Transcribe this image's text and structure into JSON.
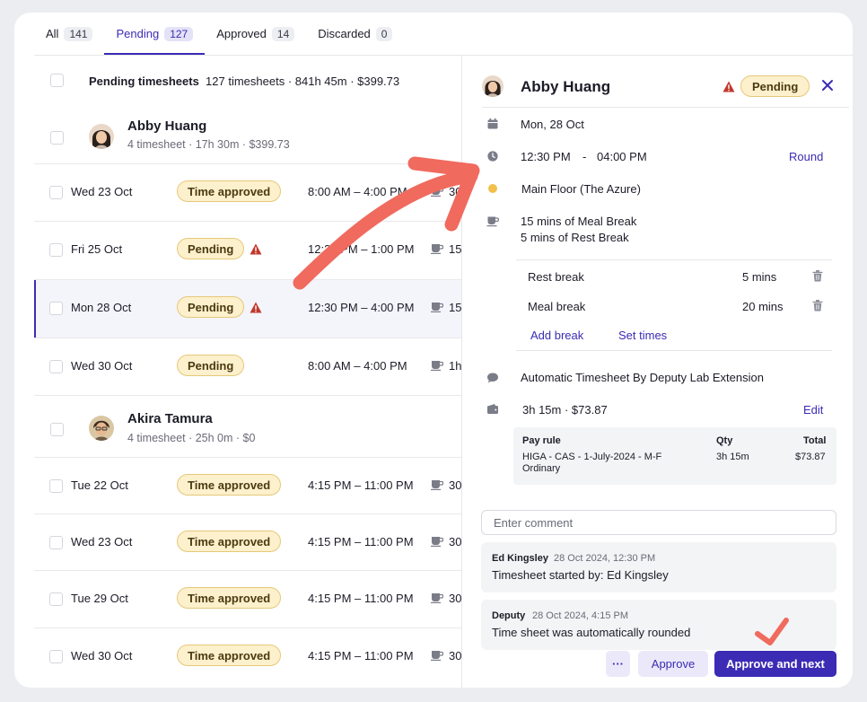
{
  "tabs": [
    {
      "label": "All",
      "count": "141"
    },
    {
      "label": "Pending",
      "count": "127"
    },
    {
      "label": "Approved",
      "count": "14"
    },
    {
      "label": "Discarded",
      "count": "0"
    }
  ],
  "summary": {
    "title": "Pending timesheets",
    "details": "127 timesheets · 841h 45m · $399.73"
  },
  "groups": [
    {
      "name": "Abby Huang",
      "meta": "4 timesheet · 17h 30m · $399.73"
    },
    {
      "name": "Akira Tamura",
      "meta": "4 timesheet · 25h 0m · $0"
    }
  ],
  "rows": [
    {
      "date": "Wed 23 Oct",
      "status": "Time approved",
      "time": "8:00 AM – 4:00 PM",
      "break": "30"
    },
    {
      "date": "Fri 25 Oct",
      "status": "Pending",
      "time": "12:30 PM – 1:00 PM",
      "break": "15"
    },
    {
      "date": "Mon 28 Oct",
      "status": "Pending",
      "time": "12:30 PM – 4:00 PM",
      "break": "15"
    },
    {
      "date": "Wed 30 Oct",
      "status": "Pending",
      "time": "8:00 AM – 4:00 PM",
      "break": "1h"
    },
    {
      "date": "Tue 22 Oct",
      "status": "Time approved",
      "time": "4:15 PM – 11:00 PM",
      "break": "30"
    },
    {
      "date": "Wed 23 Oct",
      "status": "Time approved",
      "time": "4:15 PM – 11:00 PM",
      "break": "30"
    },
    {
      "date": "Tue 29 Oct",
      "status": "Time approved",
      "time": "4:15 PM – 11:00 PM",
      "break": "30"
    },
    {
      "date": "Wed 30 Oct",
      "status": "Time approved",
      "time": "4:15 PM – 11:00 PM",
      "break": "30"
    }
  ],
  "detail": {
    "name": "Abby Huang",
    "status": "Pending",
    "date": "Mon, 28 Oct",
    "start": "12:30 PM",
    "separator": "-",
    "end": "04:00 PM",
    "round_label": "Round",
    "location": "Main Floor (The Azure)",
    "break_summary_1": "15 mins of Meal Break",
    "break_summary_2": "5 mins of Rest Break",
    "breaks": [
      {
        "label": "Rest break",
        "value": "5 mins"
      },
      {
        "label": "Meal break",
        "value": "20 mins"
      }
    ],
    "add_break": "Add break",
    "set_times": "Set times",
    "source": "Automatic Timesheet By Deputy Lab Extension",
    "cost": "3h 15m  · $73.87",
    "edit_label": "Edit",
    "pay_table": {
      "headers": [
        "Pay rule",
        "Qty",
        "Total"
      ],
      "rule": "HIGA - CAS - 1-July-2024 - M-F Ordinary",
      "qty": "3h 15m",
      "total": "$73.87"
    },
    "comment_placeholder": "Enter comment",
    "notes": [
      {
        "who": "Ed Kingsley",
        "when": "28 Oct 2024, 12:30 PM",
        "msg": "Timesheet started by: Ed Kingsley"
      },
      {
        "who": "Deputy",
        "when": "28 Oct 2024, 4:15 PM",
        "msg": "Time sheet was automatically rounded"
      }
    ],
    "more_label": "···",
    "approve_label": "Approve",
    "approve_next_label": "Approve and next"
  },
  "colors": {
    "accent": "#3b2bb5",
    "badge_bg": "#fdf0cc",
    "warning": "#c0392b",
    "annotation": "#f06a5e"
  }
}
